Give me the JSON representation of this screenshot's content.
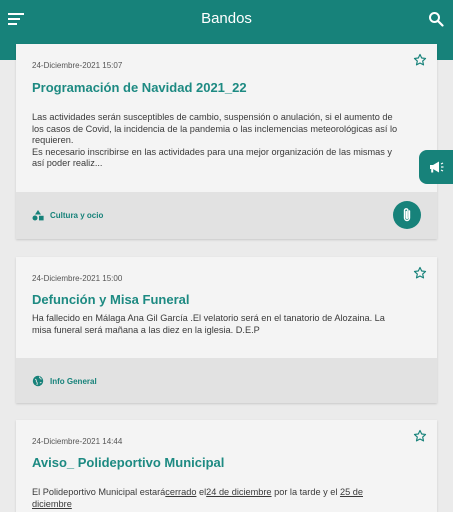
{
  "appbar": {
    "title": "Bandos"
  },
  "icons": {
    "menu": "menu-icon",
    "search": "search-icon",
    "star": "star-outline-icon",
    "attach": "paperclip-icon",
    "megaphone": "megaphone-icon",
    "culture": "shapes-icon",
    "globe": "globe-icon"
  },
  "colors": {
    "primary": "#17827a",
    "title": "#1d8a82"
  },
  "bandos": [
    {
      "date": "24-Diciembre-2021 15:07",
      "title": "Programación de Navidad 2021_22",
      "body": "Las actividades serán susceptibles de cambio, suspensión o anulación, si el aumento de los casos de Covid, la incidencia de la pandemia o las inclemencias meteorológicas así lo requieren.\nEs necesario inscribirse en las actividades para una mejor organización de las mismas y así poder realiz...",
      "category": "Cultura y ocio"
    },
    {
      "date": "24-Diciembre-2021 15:00",
      "title": "Defunción y Misa Funeral",
      "body": "Ha fallecido en Málaga Ana Gil García .El velatorio será en el tanatorio de Alozaina. La misa funeral será mañana a las diez en la iglesia.  D.E.P",
      "category": "Info General"
    },
    {
      "date": "24-Diciembre-2021 14:44",
      "title": "Aviso_ Polideportivo Municipal",
      "body_parts": [
        "El Polideportivo Municipal estará",
        "cerrado",
        " el",
        "24 de diciembre",
        " por la tarde y el ",
        "25 de diciembre"
      ]
    }
  ]
}
